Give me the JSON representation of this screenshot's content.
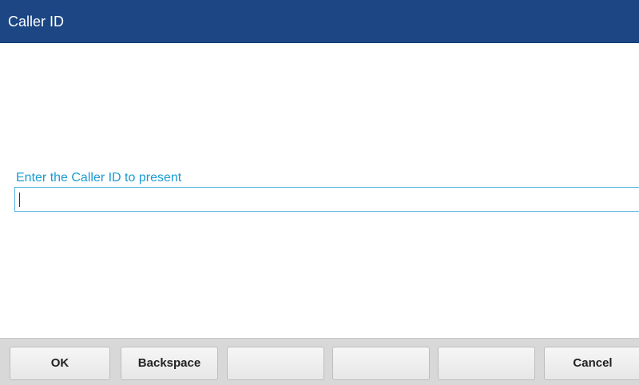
{
  "header": {
    "title": "Caller ID"
  },
  "form": {
    "prompt": "Enter the Caller ID to present",
    "caller_id_value": ""
  },
  "softkeys": [
    {
      "label": "OK"
    },
    {
      "label": "Backspace"
    },
    {
      "label": ""
    },
    {
      "label": ""
    },
    {
      "label": ""
    },
    {
      "label": "Cancel"
    }
  ],
  "colors": {
    "title_bar": "#1c4684",
    "prompt_text": "#1a9bd3",
    "input_border": "#4fb3de",
    "softkey_bar": "#d8d8d8"
  }
}
